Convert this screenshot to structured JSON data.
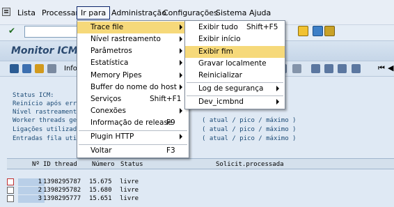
{
  "menubar": {
    "items": [
      "Lista",
      "Processar",
      "Ir para",
      "Administração",
      "Configurações",
      "Sistema",
      "Ajuda"
    ],
    "active": "Ir para"
  },
  "title": "Monitor ICM c",
  "toolbar2": {
    "info_label": "Info"
  },
  "status": {
    "lines": [
      "Status ICM:",
      "Reinício após err",
      "Nível rastreament",
      "Worker threads ge",
      "Ligações utilizad",
      "Entradas fila uti"
    ],
    "sample_text": "( atual / pico / máximo )"
  },
  "table": {
    "headers": [
      "Nº",
      "ID thread",
      "Número",
      "Status",
      "Solicit.processada"
    ],
    "rows": [
      {
        "n": "1",
        "thread": "1398295787",
        "numero": "15.675",
        "status": "livre"
      },
      {
        "n": "2",
        "thread": "1398295782",
        "numero": "15.680",
        "status": "livre"
      },
      {
        "n": "3",
        "thread": "1398295777",
        "numero": "15.651",
        "status": "livre"
      }
    ]
  },
  "goto_menu": {
    "items": [
      {
        "label": "Trace file",
        "shortcut": "",
        "submenu": true,
        "highlighted": true
      },
      {
        "label": "Nível rastreamento",
        "shortcut": "",
        "submenu": true
      },
      {
        "label": "Parâmetros",
        "shortcut": "",
        "submenu": true
      },
      {
        "label": "Estatística",
        "shortcut": "",
        "submenu": true
      },
      {
        "label": "Memory Pipes",
        "shortcut": "",
        "submenu": true
      },
      {
        "label": "Buffer do nome do host",
        "shortcut": "",
        "submenu": true
      },
      {
        "label": "Serviços",
        "shortcut": "Shift+F1",
        "submenu": false
      },
      {
        "label": "Conexões",
        "shortcut": "",
        "submenu": true
      },
      {
        "label": "Informação de release",
        "shortcut": "F9",
        "submenu": false
      },
      {
        "label": "Plugin HTTP",
        "shortcut": "",
        "submenu": true
      },
      {
        "label": "Voltar",
        "shortcut": "F3",
        "submenu": false
      }
    ]
  },
  "trace_submenu": {
    "items": [
      {
        "label": "Exibir tudo",
        "shortcut": "Shift+F5",
        "submenu": false
      },
      {
        "label": "Exibir início",
        "shortcut": "",
        "submenu": false
      },
      {
        "label": "Exibir fim",
        "shortcut": "",
        "submenu": false,
        "highlighted": true
      },
      {
        "label": "Gravar localmente",
        "shortcut": "",
        "submenu": false
      },
      {
        "label": "Reinicializar",
        "shortcut": "",
        "submenu": false
      },
      {
        "label": "Log de segurança",
        "shortcut": "",
        "submenu": true
      },
      {
        "label": "Dev_icmbnd",
        "shortcut": "",
        "submenu": true
      }
    ]
  },
  "colors": {
    "highlight": "#f6d97a",
    "title": "#2b4a70",
    "status_text": "#1c4b76"
  }
}
